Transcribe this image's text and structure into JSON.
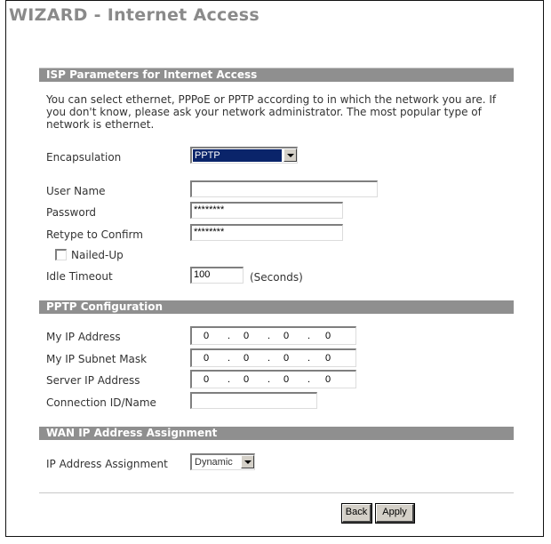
{
  "page": {
    "title": "WIZARD - Internet Access"
  },
  "isp": {
    "section_title": "ISP Parameters for Internet Access",
    "description": "You can select ethernet, PPPoE or PPTP according to in which the network you are. If you don't know, please ask your network administrator. The most popular type of network is ethernet.",
    "encapsulation_label": "Encapsulation",
    "encapsulation_value": "PPTP",
    "user_name_label": "User Name",
    "user_name_value": "",
    "password_label": "Password",
    "password_value": "********",
    "retype_label": "Retype to Confirm",
    "retype_value": "********",
    "nailed_up_label": "Nailed-Up",
    "nailed_up_checked": false,
    "idle_timeout_label": "Idle Timeout",
    "idle_timeout_value": "100",
    "idle_timeout_unit": "(Seconds)"
  },
  "pptp": {
    "section_title": "PPTP Configuration",
    "my_ip_label": "My IP Address",
    "my_ip": [
      "0",
      "0",
      "0",
      "0"
    ],
    "subnet_label": "My IP Subnet Mask",
    "subnet": [
      "0",
      "0",
      "0",
      "0"
    ],
    "server_ip_label": "Server IP Address",
    "server_ip": [
      "0",
      "0",
      "0",
      "0"
    ],
    "connection_label": "Connection ID/Name",
    "connection_value": "",
    "ip_separator": "."
  },
  "wan": {
    "section_title": "WAN IP Address Assignment",
    "assignment_label": "IP Address Assignment",
    "assignment_value": "Dynamic"
  },
  "buttons": {
    "back": "Back",
    "apply": "Apply"
  }
}
